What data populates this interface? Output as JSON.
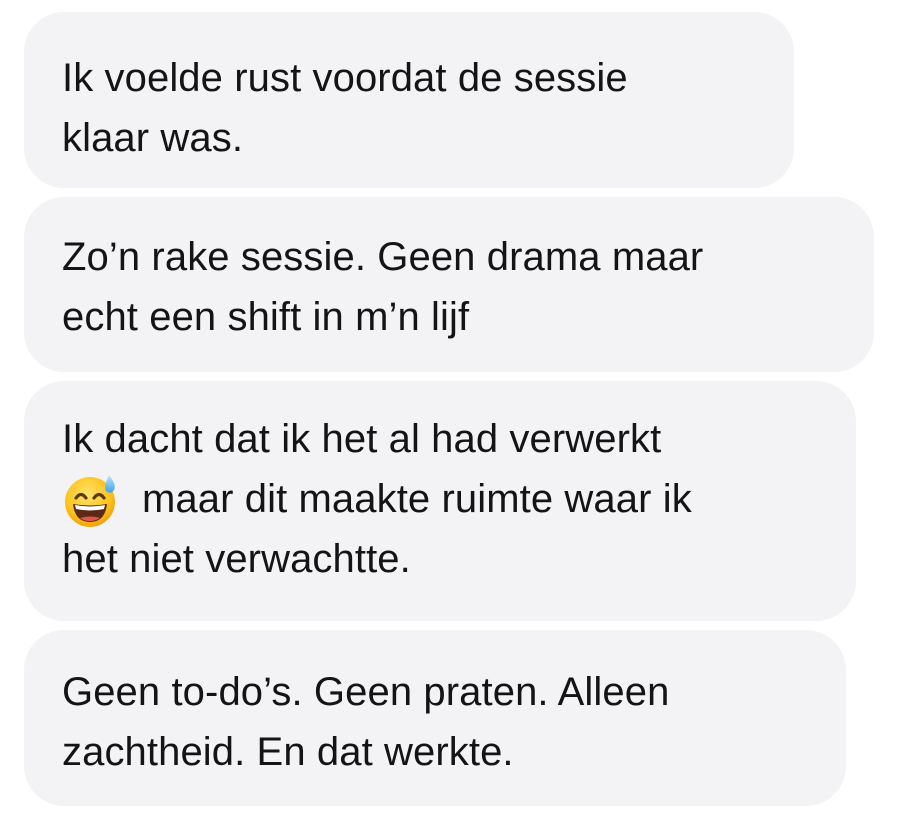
{
  "messages": [
    {
      "lines": [
        "Ik voelde rust voordat de sessie",
        "klaar was."
      ]
    },
    {
      "lines": [
        "Zo’n rake sessie. Geen drama maar",
        "echt een shift in m’n lijf"
      ]
    },
    {
      "line1": "Ik dacht dat ik het al had verwerkt",
      "emoji": "grinning-face-with-sweat-icon",
      "line2": "maar dit maakte ruimte waar ik",
      "line3": "het niet verwachtte."
    },
    {
      "lines": [
        "Geen to-do’s. Geen praten. Alleen",
        "zachtheid. En dat werkte."
      ]
    }
  ]
}
